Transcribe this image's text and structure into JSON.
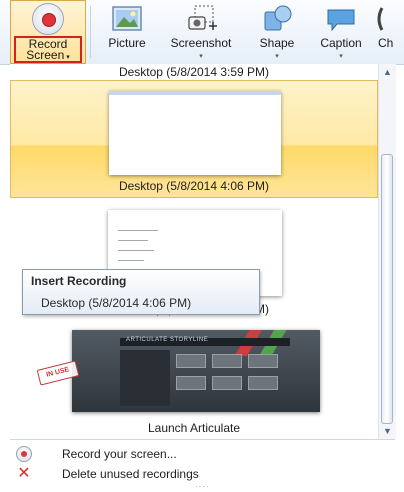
{
  "ribbon": {
    "record_screen": {
      "label_line1": "Record",
      "label_line2": "Screen",
      "icon": "record-icon"
    },
    "picture": {
      "label": "Picture",
      "icon": "picture-icon"
    },
    "screenshot": {
      "label": "Screenshot",
      "icon": "screenshot-icon"
    },
    "shape": {
      "label": "Shape",
      "icon": "shape-icon"
    },
    "caption": {
      "label": "Caption",
      "icon": "caption-icon"
    },
    "partial_next": {
      "label": "Ch"
    }
  },
  "gallery": {
    "items": [
      {
        "caption": "Desktop (5/8/2014 3:59 PM)"
      },
      {
        "caption": "Desktop (5/8/2014 4:06 PM)"
      },
      {
        "caption": "Desktop (5/8/2014 4:14 PM)"
      },
      {
        "caption": "Launch Articulate",
        "thumb_title": "ARTICULATE STORYLINE",
        "stamp": "IN USE"
      }
    ]
  },
  "tooltip": {
    "title": "Insert Recording",
    "body": "Desktop (5/8/2014 4:06 PM)"
  },
  "commands": {
    "record": {
      "label": "Record your screen...",
      "icon": "record-icon"
    },
    "delete": {
      "label": "Delete unused recordings",
      "icon": "delete-icon"
    }
  },
  "colors": {
    "selection": "#ffe9a6",
    "record_red": "#e0343a",
    "highlight_border": "#d32020"
  }
}
